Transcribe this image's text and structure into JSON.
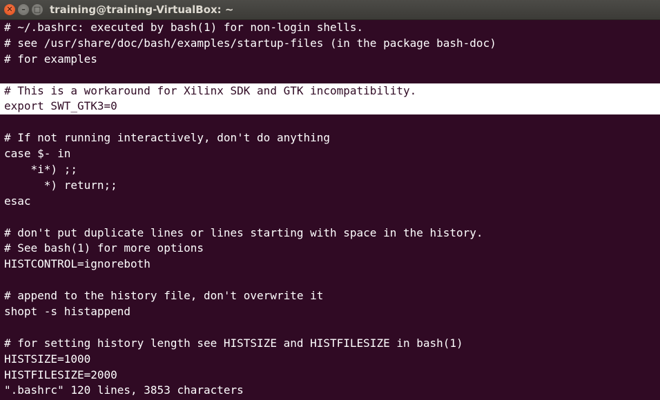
{
  "window": {
    "title": "training@training-VirtualBox: ~",
    "controls": {
      "close_glyph": "✕",
      "minimize_glyph": "–",
      "maximize_glyph": "□"
    }
  },
  "colors": {
    "terminal_background": "#300a24",
    "terminal_text": "#ffffff",
    "highlight_background": "#ffffff",
    "highlight_text": "#300a24",
    "close_button": "#df4a16"
  },
  "terminal": {
    "lines": [
      "# ~/.bashrc: executed by bash(1) for non-login shells.",
      "# see /usr/share/doc/bash/examples/startup-files (in the package bash-doc)",
      "# for examples",
      "",
      "# This is a workaround for Xilinx SDK and GTK incompatibility.",
      "export SWT_GTK3=0",
      "",
      "# If not running interactively, don't do anything",
      "case $- in",
      "    *i*) ;;",
      "      *) return;;",
      "esac",
      "",
      "# don't put duplicate lines or lines starting with space in the history.",
      "# See bash(1) for more options",
      "HISTCONTROL=ignoreboth",
      "",
      "# append to the history file, don't overwrite it",
      "shopt -s histappend",
      "",
      "# for setting history length see HISTSIZE and HISTFILESIZE in bash(1)",
      "HISTSIZE=1000",
      "HISTFILESIZE=2000"
    ],
    "highlighted_lines": [
      4,
      5
    ],
    "status_line": "\".bashrc\" 120 lines, 3853 characters"
  }
}
